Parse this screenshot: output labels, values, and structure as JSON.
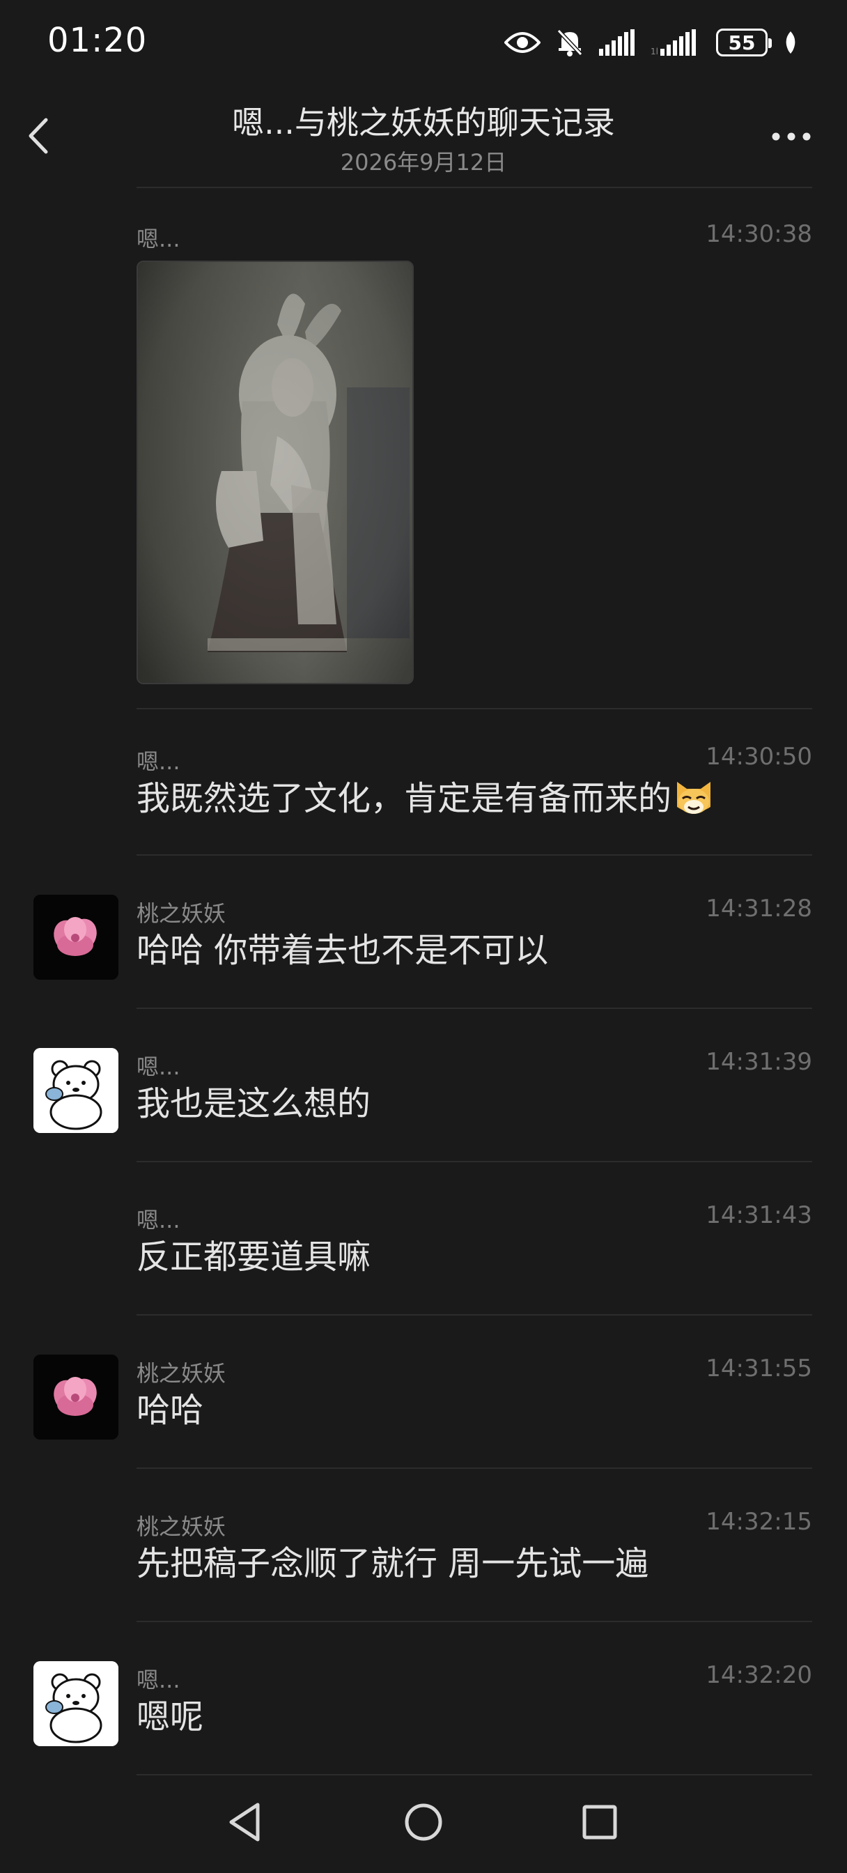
{
  "status_bar": {
    "time": "01:20",
    "battery": "55",
    "icons": [
      "eye-icon",
      "bell-off-icon",
      "signal-icon",
      "signal-icon-2",
      "battery-icon",
      "leaf-icon"
    ]
  },
  "header": {
    "title": "嗯...与桃之妖妖的聊天记录",
    "date": "2026年9月12日",
    "back_icon": "chevron-left-icon",
    "more_icon": "more-dots-icon"
  },
  "messages": [
    {
      "sender": "嗯...",
      "time": "14:30:38",
      "type": "image",
      "avatar": "none"
    },
    {
      "sender": "嗯...",
      "time": "14:30:50",
      "text": "我既然选了文化，肯定是有备而来的",
      "emoji": "cat-face-emoji",
      "avatar": "none"
    },
    {
      "sender": "桃之妖妖",
      "time": "14:31:28",
      "text": "哈哈 你带着去也不是不可以",
      "avatar": "flower-avatar"
    },
    {
      "sender": "嗯...",
      "time": "14:31:39",
      "text": "我也是这么想的",
      "avatar": "bear-avatar"
    },
    {
      "sender": "嗯...",
      "time": "14:31:43",
      "text": "反正都要道具嘛",
      "avatar": "none"
    },
    {
      "sender": "桃之妖妖",
      "time": "14:31:55",
      "text": "哈哈",
      "avatar": "flower-avatar"
    },
    {
      "sender": "桃之妖妖",
      "time": "14:32:15",
      "text": "先把稿子念顺了就行 周一先试一遍",
      "avatar": "none"
    },
    {
      "sender": "嗯...",
      "time": "14:32:20",
      "text": "嗯呢",
      "avatar": "bear-avatar"
    }
  ],
  "nav_bar": {
    "icons": [
      "back-triangle-icon",
      "home-circle-icon",
      "recents-square-icon"
    ]
  },
  "colors": {
    "background": "#1a1a1a",
    "text": "#e4e4e4",
    "muted": "#8a8a8a",
    "divider": "#2c2c2c"
  }
}
